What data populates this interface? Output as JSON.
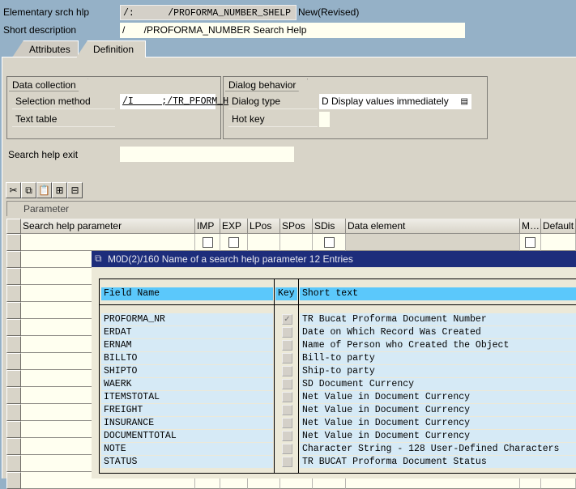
{
  "header": {
    "srch_hlp_label": "Elementary srch hlp",
    "srch_hlp_value": "/:      /PROFORMA_NUMBER_SHELP",
    "status": "New(Revised)",
    "short_desc_label": "Short description",
    "short_desc_value": "/       /PROFORMA_NUMBER Search Help"
  },
  "tabs": [
    {
      "label": "Attributes"
    },
    {
      "label": "Definition",
      "active": true
    }
  ],
  "data_collection": {
    "title": "Data collection",
    "selection_method_label": "Selection method",
    "selection_method_value": "/I     ;/TR_PFORM_H",
    "text_table_label": "Text table"
  },
  "dialog_behavior": {
    "title": "Dialog behavior",
    "dialog_type_label": "Dialog type",
    "dialog_type_value": "D Display values immediately",
    "hot_key_label": "Hot key"
  },
  "search_help_exit_label": "Search help exit",
  "toolbar": {
    "icons": [
      "cut-icon",
      "copy-icon",
      "paste-icon",
      "insert-row-icon",
      "delete-row-icon"
    ],
    "glyphs": [
      "✂",
      "⧉",
      "📋",
      "⊞",
      "⊟"
    ]
  },
  "parameter_section": "Parameter",
  "param_table": {
    "columns": [
      "Search help parameter",
      "IMP",
      "EXP",
      "LPos",
      "SPos",
      "SDis",
      "Data element",
      "M…",
      "Default"
    ]
  },
  "popup": {
    "title": "M0D(2)/160 Name of a search help parameter 12 Entries",
    "col_field": "Field Name",
    "col_key": "Key",
    "col_short": "Short text",
    "entries": [
      {
        "field": "PROFORMA_NR",
        "key": true,
        "text": "TR Bucat Proforma Document Number"
      },
      {
        "field": "ERDAT",
        "key": false,
        "text": "Date on Which Record Was Created"
      },
      {
        "field": "ERNAM",
        "key": false,
        "text": "Name of Person who Created the Object"
      },
      {
        "field": "BILLTO",
        "key": false,
        "text": "Bill-to party"
      },
      {
        "field": "SHIPTO",
        "key": false,
        "text": "Ship-to party"
      },
      {
        "field": "WAERK",
        "key": false,
        "text": "SD Document Currency"
      },
      {
        "field": "ITEMSTOTAL",
        "key": false,
        "text": "Net Value in Document Currency"
      },
      {
        "field": "FREIGHT",
        "key": false,
        "text": "Net Value in Document Currency"
      },
      {
        "field": "INSURANCE",
        "key": false,
        "text": "Net Value in Document Currency"
      },
      {
        "field": "DOCUMENTTOTAL",
        "key": false,
        "text": "Net Value in Document Currency"
      },
      {
        "field": "NOTE",
        "key": false,
        "text": "Character String - 128 User-Defined Characters"
      },
      {
        "field": "STATUS",
        "key": false,
        "text": "TR BUCAT Proforma Document Status"
      }
    ]
  },
  "colors": {
    "title_bar": "#1d2d7b",
    "header_blue": "#5bc8fb",
    "row_blue": "#d6eaf6",
    "background": "#95b1c7",
    "panel": "#d8d4c8"
  }
}
